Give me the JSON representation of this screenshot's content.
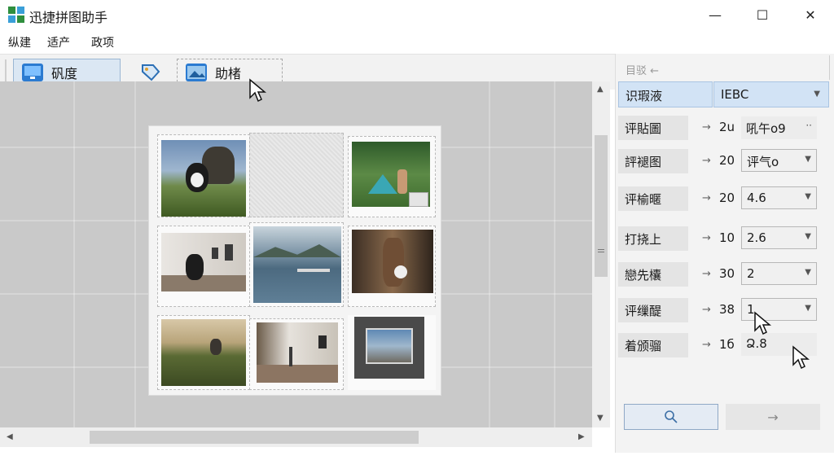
{
  "app": {
    "title": "迅捷拼图助手"
  },
  "window_controls": {
    "minimize": "—",
    "maximize": "☐",
    "close": "✕"
  },
  "menu": [
    "纵建",
    "适产",
    "政项"
  ],
  "toolbar": {
    "btn1_label": "矾度",
    "btn3_label": "助楮"
  },
  "panel": {
    "caption": "目驳 ←",
    "top_label": "识瑕液",
    "top_value": "IEBC",
    "rows": [
      {
        "label": "评貼圖",
        "num": "2u",
        "value": "吼午o9",
        "control": "text"
      },
      {
        "label": "評褪图",
        "num": "20",
        "value": "评气o",
        "control": "select"
      },
      {
        "label": "评榆暱",
        "num": "20",
        "value": "4.6",
        "control": "select"
      },
      {
        "label": "打挠上",
        "num": "10",
        "value": "2.6",
        "control": "select"
      },
      {
        "label": "戀先欜",
        "num": "30",
        "value": "2",
        "control": "select"
      },
      {
        "label": "评缫醍",
        "num": "38",
        "value": "1",
        "control": "select"
      },
      {
        "label": "着颁骝",
        "num": "1б",
        "value": "Ձ.8",
        "control": "text"
      }
    ],
    "next_label": "→"
  },
  "colors": {
    "accent": "#d2e3f5",
    "canvas": "#c9c9c9"
  }
}
